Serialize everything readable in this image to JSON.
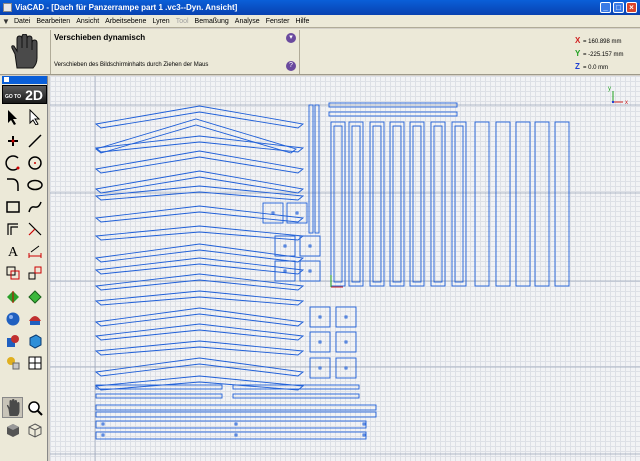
{
  "window": {
    "title": "ViaCAD - [Dach für Panzerrampe part 1 .vc3--Dyn. Ansicht]",
    "min": "_",
    "max": "□",
    "close": "×"
  },
  "menu": [
    {
      "label": "Datei",
      "disabled": false
    },
    {
      "label": "Bearbeiten",
      "disabled": false
    },
    {
      "label": "Ansicht",
      "disabled": false
    },
    {
      "label": "Arbeitsebene",
      "disabled": false
    },
    {
      "label": "Lyren",
      "disabled": false
    },
    {
      "label": "Tool",
      "disabled": true
    },
    {
      "label": "Bemaßung",
      "disabled": false
    },
    {
      "label": "Analyse",
      "disabled": false
    },
    {
      "label": "Fenster",
      "disabled": false
    },
    {
      "label": "Hilfe",
      "disabled": false
    }
  ],
  "command": {
    "title": "Verschieben dynamisch",
    "hint": "Verschieben des Bildschirminhalts durch Ziehen der Maus",
    "dropdown": "▾",
    "help": "?"
  },
  "coords": {
    "x_label": "X",
    "x": "= 160.898 mm",
    "y_label": "Y",
    "y": "= -225.157 mm",
    "z_label": "Z",
    "z": "= 0.0 mm"
  },
  "toolbar": {
    "goto_small": "GO TO",
    "goto_big": "2D"
  },
  "axis_labels": {
    "x": "x",
    "y": "y"
  },
  "colors": {
    "title": "#0a5fd8",
    "part": "#1f5fd8",
    "grid_major": "#9aa4b8",
    "bg": "#f2f3f5",
    "xaxis": "#d02020",
    "yaxis": "#20a020",
    "zaxis": "#2040d0"
  }
}
